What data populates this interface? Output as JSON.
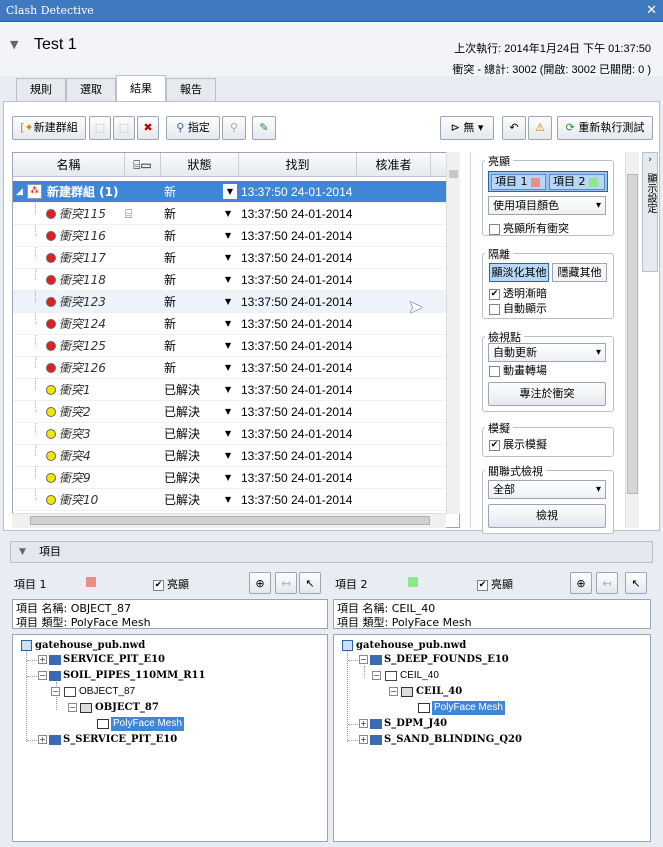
{
  "window": {
    "title": "Clash Detective",
    "close": "✕"
  },
  "header": {
    "test_name": "Test 1",
    "last_run_label": "上次執行:",
    "last_run": "2014年1月24日 下午 01:37:50",
    "totals_label": "衝突 - 總計: 3002 (開啟: 3002 已關閉: 0 )"
  },
  "tabs": [
    {
      "label": "規則"
    },
    {
      "label": "選取"
    },
    {
      "label": "結果"
    },
    {
      "label": "報告"
    }
  ],
  "toolbar": {
    "new_group": "新建群組",
    "assign": "指定",
    "filter": "無",
    "rerun": "重新執行測試"
  },
  "grid": {
    "columns": [
      "名稱",
      "狀態",
      "找到",
      "核准者"
    ],
    "group": {
      "name": "新建群組 (1)",
      "status": "新",
      "found": "13:37:50 24-01-2014"
    },
    "rows": [
      {
        "name": "衝突115",
        "status": "新",
        "found": "13:37:50 24-01-2014",
        "color": "#e02020",
        "cam": true
      },
      {
        "name": "衝突116",
        "status": "新",
        "found": "13:37:50 24-01-2014",
        "color": "#e02020"
      },
      {
        "name": "衝突117",
        "status": "新",
        "found": "13:37:50 24-01-2014",
        "color": "#e02020"
      },
      {
        "name": "衝突118",
        "status": "新",
        "found": "13:37:50 24-01-2014",
        "color": "#e02020"
      },
      {
        "name": "衝突123",
        "status": "新",
        "found": "13:37:50 24-01-2014",
        "color": "#e02020"
      },
      {
        "name": "衝突124",
        "status": "新",
        "found": "13:37:50 24-01-2014",
        "color": "#e02020"
      },
      {
        "name": "衝突125",
        "status": "新",
        "found": "13:37:50 24-01-2014",
        "color": "#e02020"
      },
      {
        "name": "衝突126",
        "status": "新",
        "found": "13:37:50 24-01-2014",
        "color": "#e02020"
      },
      {
        "name": "衝突1",
        "status": "已解決",
        "found": "13:37:50 24-01-2014",
        "color": "#f2e600"
      },
      {
        "name": "衝突2",
        "status": "已解決",
        "found": "13:37:50 24-01-2014",
        "color": "#f2e600"
      },
      {
        "name": "衝突3",
        "status": "已解決",
        "found": "13:37:50 24-01-2014",
        "color": "#f2e600"
      },
      {
        "name": "衝突4",
        "status": "已解決",
        "found": "13:37:50 24-01-2014",
        "color": "#f2e600"
      },
      {
        "name": "衝突9",
        "status": "已解決",
        "found": "13:37:50 24-01-2014",
        "color": "#f2e600"
      },
      {
        "name": "衝突10",
        "status": "已解決",
        "found": "13:37:50 24-01-2014",
        "color": "#f2e600"
      }
    ]
  },
  "right": {
    "highlight_label": "亮顯",
    "item1": "項目 1",
    "item2": "項目 2",
    "item1_color": "#f08b8b",
    "item2_color": "#8de88d",
    "use_item_color": "使用項目顏色",
    "highlight_all": "亮顯所有衝突",
    "isolate_label": "隔離",
    "dim_others": "顯淡化其他",
    "hide_others": "隱藏其他",
    "transparent_dim": "透明漸暗",
    "auto_reveal": "自動顯示",
    "viewpoint_label": "檢視點",
    "auto_update": "自動更新",
    "animate": "動畫轉場",
    "focus_clash": "專注於衝突",
    "simulation_label": "模擬",
    "show_sim": "展示模擬",
    "linked_label": "關聯式檢視",
    "all": "全部",
    "view": "檢視",
    "side_tab": "顯示設定"
  },
  "items": {
    "label": "項目",
    "left": {
      "title": "項目 1",
      "resolved": "亮顯",
      "name_line": "項目 名稱: OBJECT_87",
      "type_line": "項目 類型: PolyFace Mesh"
    },
    "right": {
      "title": "項目 2",
      "resolved": "亮顯",
      "name_line": "項目 名稱: CEIL_40",
      "type_line": "項目 類型: PolyFace Mesh"
    },
    "tree_left": [
      "gatehouse_pub.nwd",
      "SERVICE_PIT_E10",
      "SOIL_PIPES_110MM_R11",
      "OBJECT_87",
      "OBJECT_87",
      "PolyFace Mesh",
      "S_SERVICE_PIT_E10"
    ],
    "tree_right": [
      "gatehouse_pub.nwd",
      "S_DEEP_FOUNDS_E10",
      "CEIL_40",
      "CEIL_40",
      "PolyFace Mesh",
      "S_DPM_J40",
      "S_SAND_BLINDING_Q20"
    ]
  }
}
